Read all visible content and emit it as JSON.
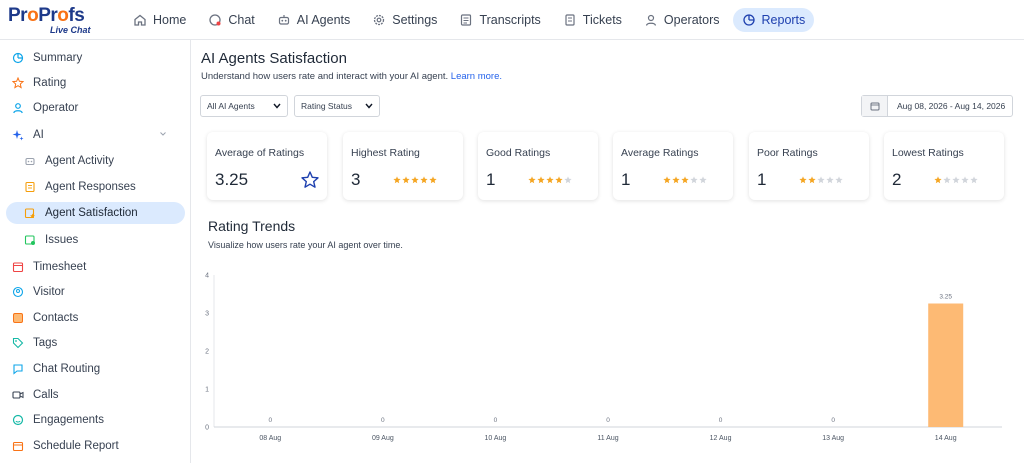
{
  "brand": {
    "name_pre": "Pr",
    "name_o1": "o",
    "name_mid": "Pr",
    "name_o2": "o",
    "name_post": "fs",
    "sub": "Live Chat"
  },
  "nav": {
    "items": [
      {
        "label": "Home",
        "icon": "home-icon"
      },
      {
        "label": "Chat",
        "icon": "chat-icon"
      },
      {
        "label": "AI Agents",
        "icon": "robot-icon"
      },
      {
        "label": "Settings",
        "icon": "gear-icon"
      },
      {
        "label": "Transcripts",
        "icon": "transcript-icon"
      },
      {
        "label": "Tickets",
        "icon": "ticket-icon"
      },
      {
        "label": "Operators",
        "icon": "operator-icon"
      },
      {
        "label": "Reports",
        "icon": "reports-icon"
      }
    ],
    "active": "Reports"
  },
  "sidebar": {
    "items": [
      {
        "label": "Summary",
        "icon": "summary-icon",
        "color": "#0ea5e9"
      },
      {
        "label": "Rating",
        "icon": "star-icon",
        "color": "#f97316"
      },
      {
        "label": "Operator",
        "icon": "user-icon",
        "color": "#0ea5e9"
      },
      {
        "label": "AI",
        "icon": "sparkle-icon",
        "color": "#2563eb"
      },
      {
        "label": "Agent Activity",
        "icon": "robot-icon",
        "color": "#9ca3af"
      },
      {
        "label": "Agent Responses",
        "icon": "responses-icon",
        "color": "#f59e0b"
      },
      {
        "label": "Agent Satisfaction",
        "icon": "satisfaction-icon",
        "color": "#f59e0b"
      },
      {
        "label": "Issues",
        "icon": "issues-icon",
        "color": "#22c55e"
      },
      {
        "label": "Timesheet",
        "icon": "timesheet-icon",
        "color": "#ef4444"
      },
      {
        "label": "Visitor",
        "icon": "visitor-icon",
        "color": "#0ea5e9"
      },
      {
        "label": "Contacts",
        "icon": "contacts-icon",
        "color": "#f97316"
      },
      {
        "label": "Tags",
        "icon": "tag-icon",
        "color": "#14b8a6"
      },
      {
        "label": "Chat Routing",
        "icon": "routing-icon",
        "color": "#0ea5e9"
      },
      {
        "label": "Calls",
        "icon": "video-icon",
        "color": "#374151"
      },
      {
        "label": "Engagements",
        "icon": "engagement-icon",
        "color": "#14b8a6"
      },
      {
        "label": "Schedule Report",
        "icon": "calendar-icon",
        "color": "#f97316"
      }
    ],
    "active": "Agent Satisfaction"
  },
  "page": {
    "title": "AI Agents Satisfaction",
    "subtitle": "Understand how users rate and interact with your AI agent.",
    "learn_more": "Learn more."
  },
  "filters": {
    "agents": "All AI Agents",
    "status": "Rating Status",
    "date_range": "Aug 08, 2026 - Aug 14, 2026"
  },
  "cards": [
    {
      "label": "Average of Ratings",
      "value": "3.25",
      "stars": null
    },
    {
      "label": "Highest Rating",
      "value": "3",
      "stars": 5
    },
    {
      "label": "Good Ratings",
      "value": "1",
      "stars": 4
    },
    {
      "label": "Average Ratings",
      "value": "1",
      "stars": 3
    },
    {
      "label": "Poor Ratings",
      "value": "1",
      "stars": 2
    },
    {
      "label": "Lowest Ratings",
      "value": "2",
      "stars": 1
    }
  ],
  "trend": {
    "title": "Rating Trends",
    "subtitle": "Visualize how users rate your AI agent over time."
  },
  "colors": {
    "accent": "#2563eb",
    "bar": "#fdba74",
    "star_filled": "#f5a623",
    "star_empty": "#d1d5db"
  },
  "chart_data": {
    "type": "bar",
    "categories": [
      "08 Aug",
      "09 Aug",
      "10 Aug",
      "11 Aug",
      "12 Aug",
      "13 Aug",
      "14 Aug"
    ],
    "values": [
      0,
      0,
      0,
      0,
      0,
      0,
      3.25
    ],
    "data_labels": [
      "0",
      "0",
      "0",
      "0",
      "0",
      "0",
      "3.25"
    ],
    "yticks": [
      "0",
      "1",
      "2",
      "3",
      "4"
    ],
    "ylim": [
      0,
      4
    ],
    "grid": false
  }
}
